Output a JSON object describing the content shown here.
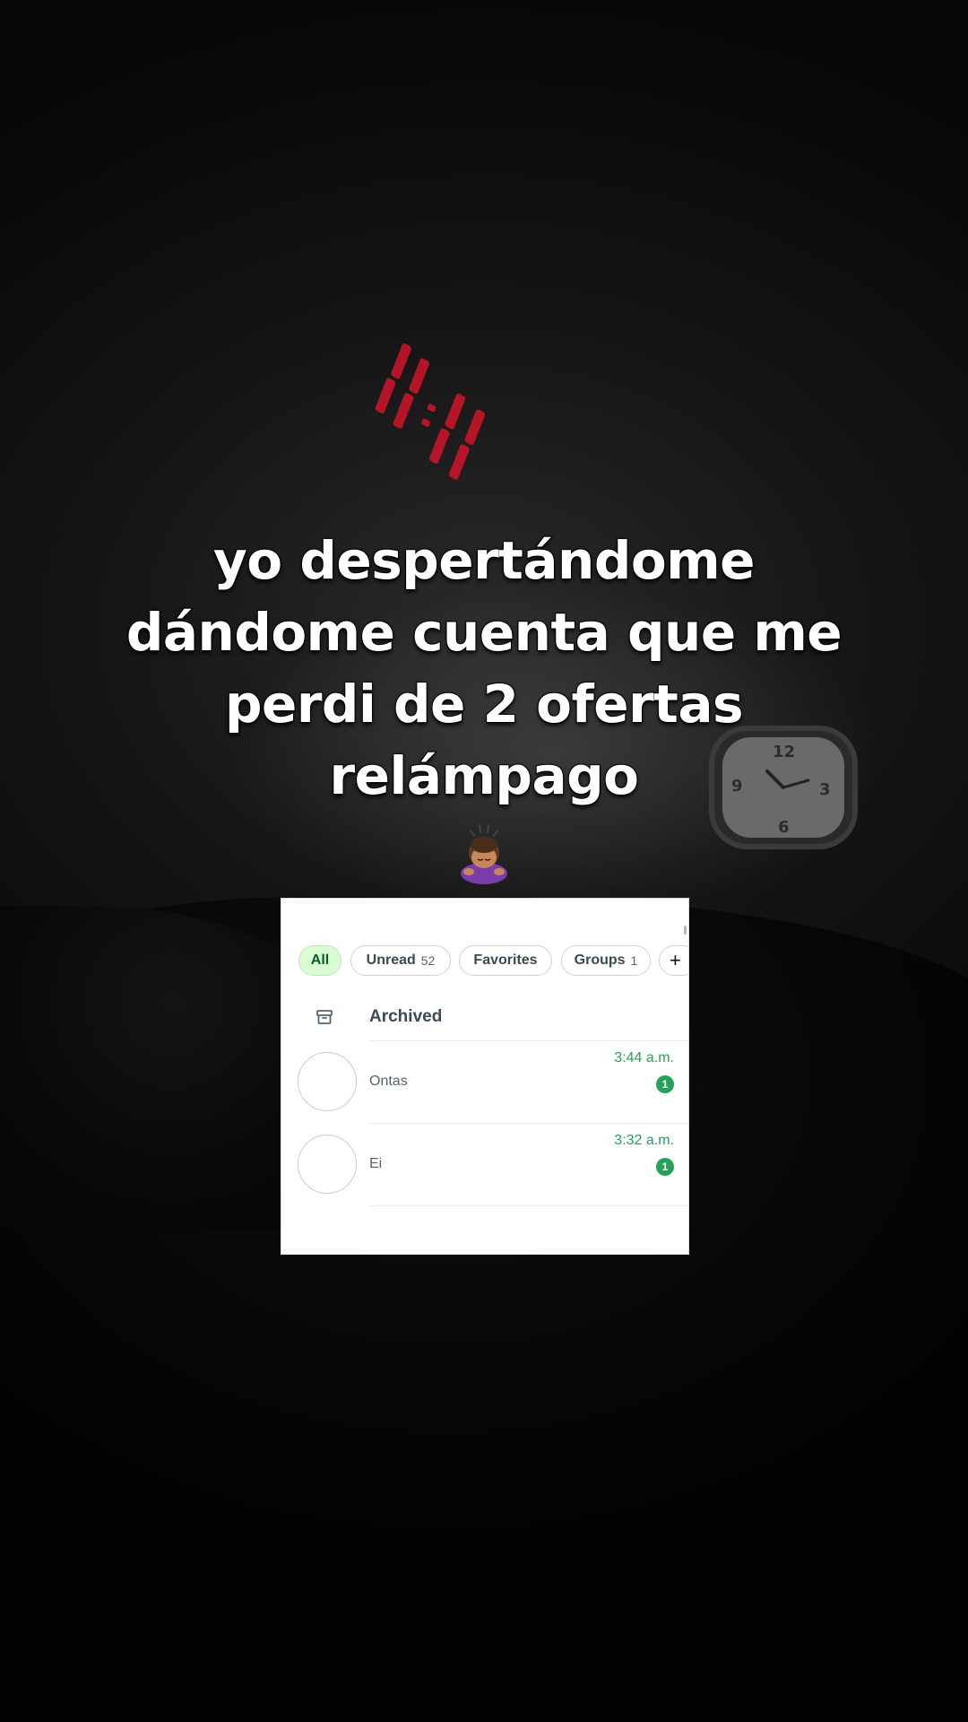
{
  "caption": {
    "line1": "yo despertándome",
    "line2": "dándome cuenta que me",
    "line3": "perdi de 2 ofertas",
    "line4": "relámpago"
  },
  "emoji": "person-bowing-emoji",
  "projection_time": "11:11",
  "screenshot": {
    "filters": {
      "all": "All",
      "unread": "Unread",
      "unread_count": "52",
      "favorites": "Favorites",
      "groups": "Groups",
      "groups_count": "1",
      "add": "+"
    },
    "archived": "Archived",
    "chats": [
      {
        "name": "Ontas",
        "time": "3:44 a.m.",
        "unread": "1"
      },
      {
        "name": "Ei",
        "time": "3:32 a.m.",
        "unread": "1"
      }
    ]
  },
  "colors": {
    "accent_green": "#25a25a",
    "chip_active_bg": "#d9fdd3",
    "projection_red": "#d0142a"
  }
}
